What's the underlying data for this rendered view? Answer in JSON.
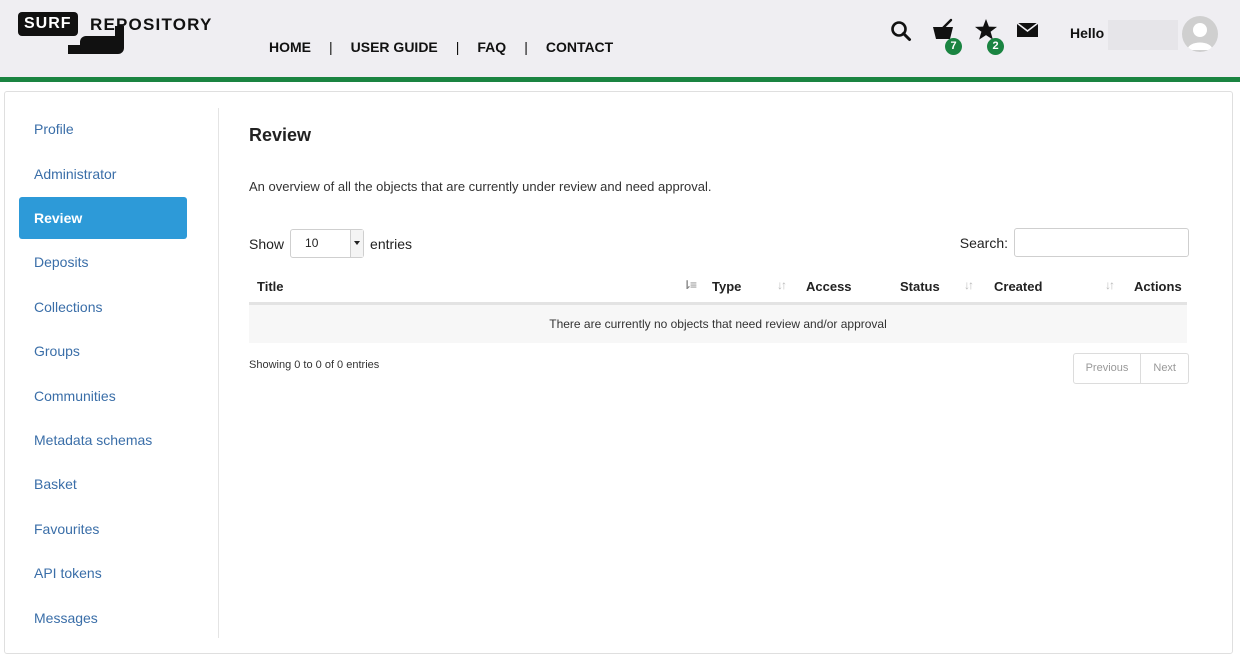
{
  "header": {
    "logo": {
      "surf": "SURF",
      "repository": "REPOSITORY"
    },
    "nav": [
      "HOME",
      "USER GUIDE",
      "FAQ",
      "CONTACT"
    ],
    "nav_separator": "|",
    "icons": {
      "search": "search-icon",
      "basket": "basket-icon",
      "favourites": "star-icon",
      "messages": "envelope-icon"
    },
    "basket_count": "7",
    "favourites_count": "2",
    "greeting": "Hello",
    "brand_green": "#1a8441"
  },
  "sidebar": {
    "items": [
      "Profile",
      "Administrator",
      "Review",
      "Deposits",
      "Collections",
      "Groups",
      "Communities",
      "Metadata schemas",
      "Basket",
      "Favourites",
      "API tokens",
      "Messages"
    ],
    "active": "Review",
    "active_color": "#2d9ad8"
  },
  "main": {
    "title": "Review",
    "description": "An overview of all the objects that are currently under review and need approval.",
    "show_label": "Show",
    "entries_value": "10",
    "entries_label": "entries",
    "search_label": "Search:",
    "search_value": "",
    "columns": [
      "Title",
      "Type",
      "Access",
      "Status",
      "Created",
      "Actions"
    ],
    "empty_message": "There are currently no objects that need review and/or approval",
    "info": "Showing 0 to 0 of 0 entries",
    "pager": {
      "previous": "Previous",
      "next": "Next"
    }
  }
}
